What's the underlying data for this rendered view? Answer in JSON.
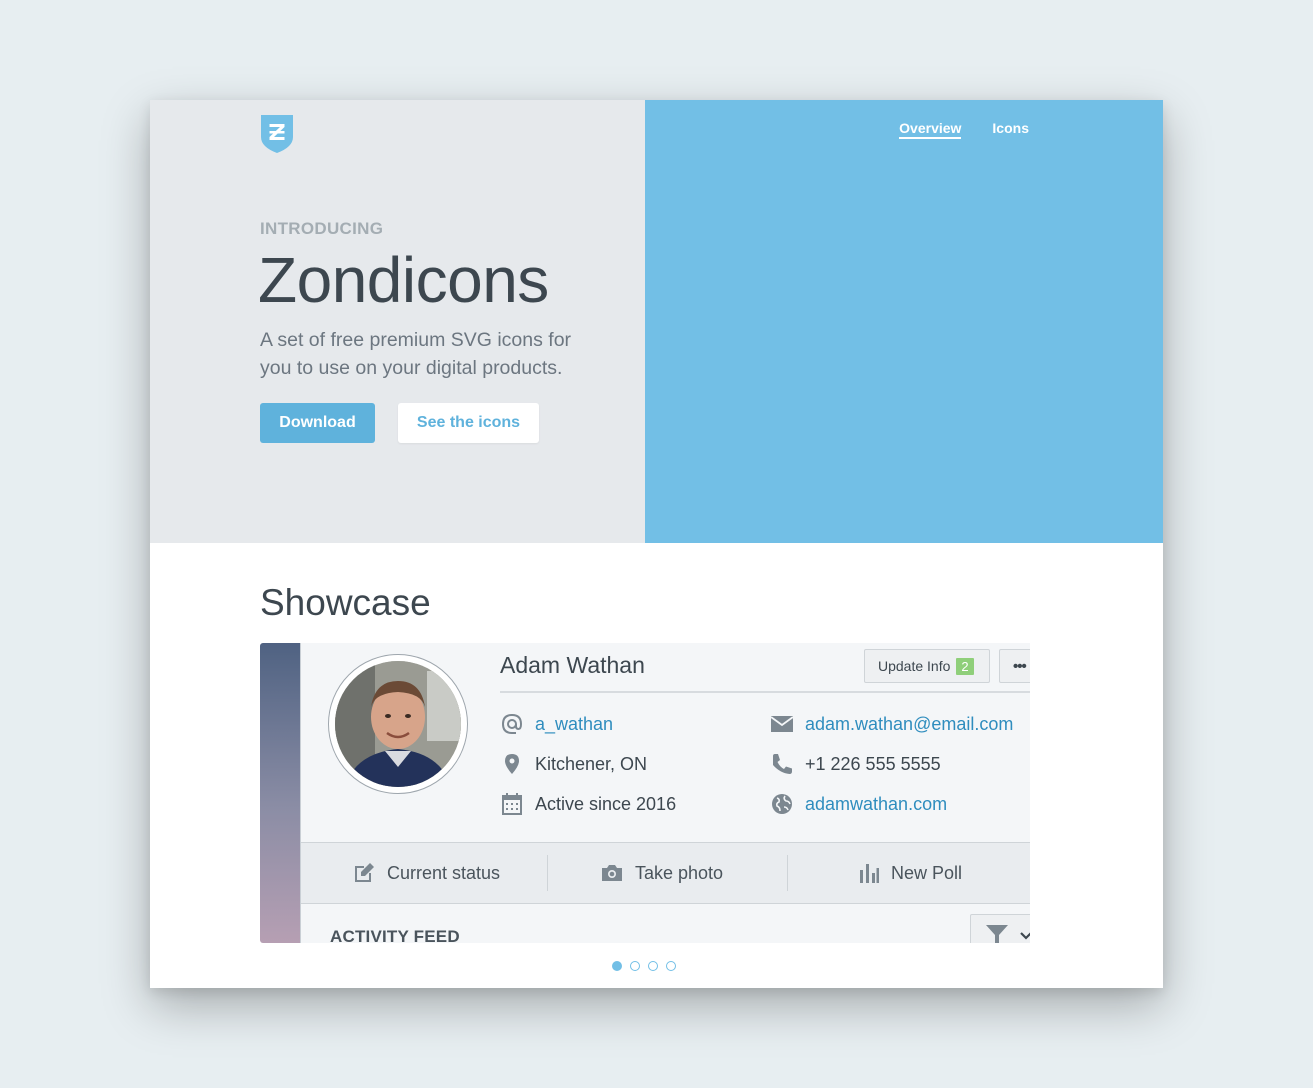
{
  "nav": {
    "items": [
      {
        "label": "Overview",
        "active": true
      },
      {
        "label": "Icons",
        "active": false
      }
    ]
  },
  "hero": {
    "eyebrow": "INTRODUCING",
    "title": "Zondicons",
    "subtitle": "A set of free premium SVG icons for you to use on your digital products.",
    "primary_button": "Download",
    "secondary_button": "See the icons"
  },
  "showcase": {
    "title": "Showcase",
    "profile": {
      "name": "Adam Wathan",
      "update_button": "Update Info",
      "update_count": "2",
      "more_button": "•••",
      "username": "a_wathan",
      "location": "Kitchener, ON",
      "active_since": "Active since 2016",
      "email": "adam.wathan@email.com",
      "phone": "+1 226 555 5555",
      "website": "adamwathan.com"
    },
    "actions": {
      "status": "Current status",
      "photo": "Take photo",
      "poll": "New Poll"
    },
    "feed_title": "ACTIVITY FEED"
  },
  "carousel": {
    "count": 4,
    "active_index": 0
  },
  "colors": {
    "background": "#e7eef1",
    "hero_left": "#e6e9ec",
    "hero_right": "#72bfe6",
    "primary": "#5fb2dc",
    "link": "#2f8dbe",
    "text_dark": "#3d474f",
    "badge_green": "#8fcf7a"
  },
  "icons": {
    "logo": "zondicons-shield-logo",
    "username": "at-icon",
    "location": "location-pin-icon",
    "active_since": "calendar-icon",
    "email": "envelope-icon",
    "phone": "phone-icon",
    "website": "globe-icon",
    "status": "edit-pencil-icon",
    "photo": "camera-icon",
    "poll": "bar-chart-icon",
    "filter": "filter-icon"
  }
}
